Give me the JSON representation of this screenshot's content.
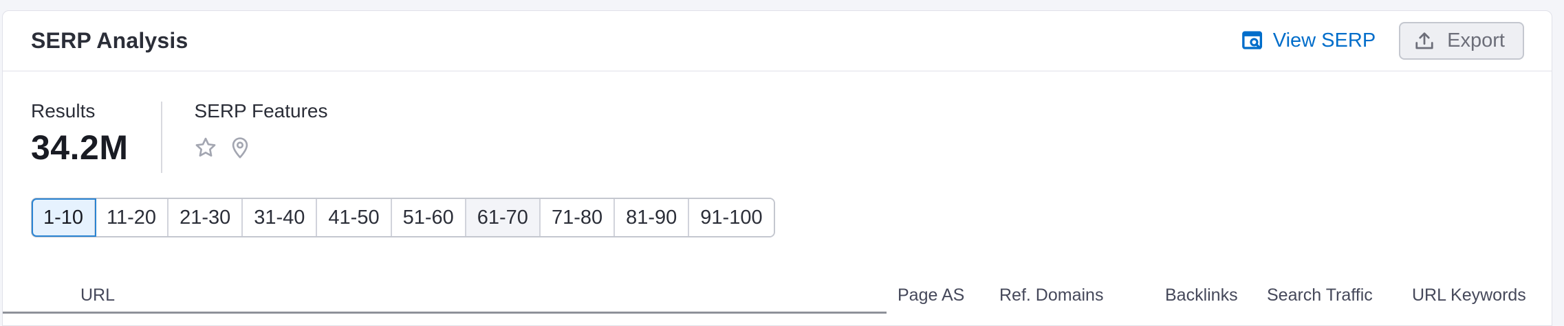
{
  "header": {
    "title": "SERP Analysis",
    "view_serp_label": "View SERP",
    "export_label": "Export"
  },
  "stats": {
    "results_label": "Results",
    "results_value": "34.2M",
    "features_label": "SERP Features",
    "feature_icons": [
      "star-icon",
      "location-pin-icon"
    ]
  },
  "pagination": {
    "pages": [
      "1-10",
      "11-20",
      "21-30",
      "31-40",
      "41-50",
      "51-60",
      "61-70",
      "71-80",
      "81-90",
      "91-100"
    ],
    "active_index": 0,
    "hovered_index": 6
  },
  "table": {
    "columns": {
      "url": "URL",
      "page_as": "Page AS",
      "ref_domains": "Ref. Domains",
      "backlinks": "Backlinks",
      "search_traffic": "Search Traffic",
      "url_keywords": "URL Keywords"
    }
  },
  "colors": {
    "accent": "#006dca",
    "active_page_bg": "#e6f2fe",
    "active_page_border": "#2a84d2",
    "icon_gray": "#a3a6b1"
  }
}
